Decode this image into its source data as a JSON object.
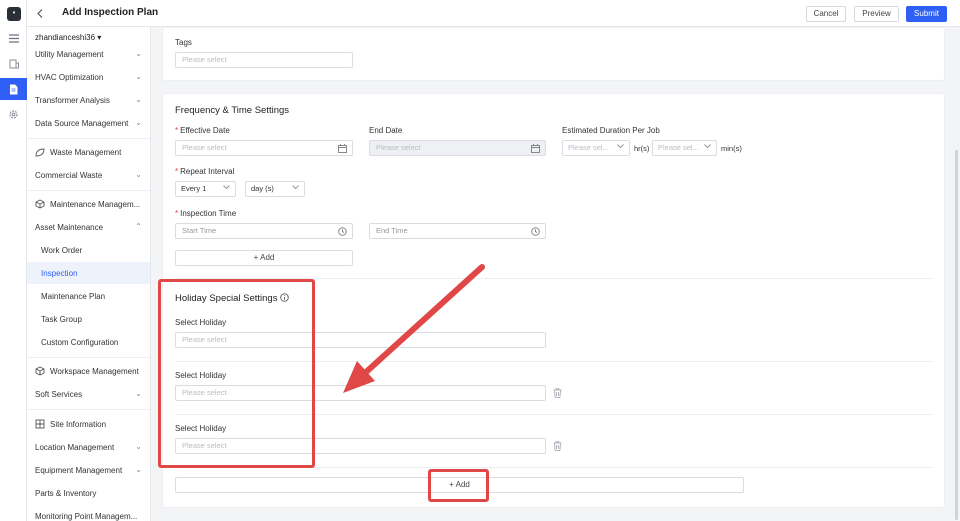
{
  "header": {
    "title": "Add Inspection Plan",
    "cancel_label": "Cancel",
    "preview_label": "Preview",
    "submit_label": "Submit"
  },
  "sidebar": {
    "project": "zhandianceshi36",
    "items": [
      {
        "label": "Utility Management"
      },
      {
        "label": "HVAC Optimization"
      },
      {
        "label": "Transformer Analysis"
      },
      {
        "label": "Data Source Management"
      },
      {
        "label": "Waste Management"
      },
      {
        "label": "Commercial Waste"
      },
      {
        "label": "Maintenance Managem..."
      },
      {
        "label": "Asset Maintenance"
      },
      {
        "label": "Work Order"
      },
      {
        "label": "Inspection"
      },
      {
        "label": "Maintenance Plan"
      },
      {
        "label": "Task Group"
      },
      {
        "label": "Custom Configuration"
      },
      {
        "label": "Workspace Management"
      },
      {
        "label": "Soft Services"
      },
      {
        "label": "Site Information"
      },
      {
        "label": "Location Management"
      },
      {
        "label": "Equipment Management"
      },
      {
        "label": "Parts & Inventory"
      },
      {
        "label": "Monitoring Point Managem..."
      }
    ]
  },
  "tags": {
    "label": "Tags",
    "placeholder": "Please select"
  },
  "frequency": {
    "title": "Frequency & Time Settings",
    "effective_date_label": "Effective Date",
    "effective_date_placeholder": "Please select",
    "end_date_label": "End Date",
    "end_date_placeholder": "Please select",
    "duration_label": "Estimated Duration Per Job",
    "duration_hr_placeholder": "Please sel...",
    "duration_hr_unit": "hr(s)",
    "duration_min_placeholder": "Please sel...",
    "duration_min_unit": "min(s)",
    "repeat_label": "Repeat Interval",
    "repeat_value": "Every 1",
    "repeat_unit": "day (s)",
    "inspection_time_label": "Inspection Time",
    "start_time_placeholder": "Start Time",
    "end_time_placeholder": "End Time",
    "add_label": "Add"
  },
  "holiday": {
    "title": "Holiday Special Settings",
    "rows": [
      {
        "label": "Select Holiday",
        "placeholder": "Please select"
      },
      {
        "label": "Select Holiday",
        "placeholder": "Please select"
      },
      {
        "label": "Select Holiday",
        "placeholder": "Please select"
      }
    ],
    "add_label": "Add"
  },
  "colors": {
    "accent": "#2f5ff5",
    "annotation": "#e04848",
    "required": "#e53935"
  }
}
